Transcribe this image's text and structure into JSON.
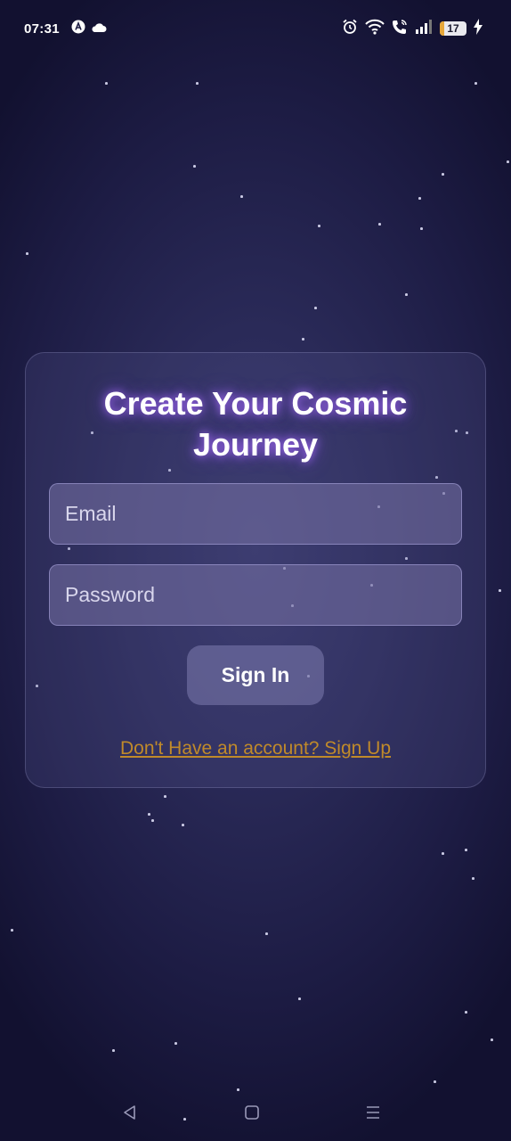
{
  "status_bar": {
    "time": "07:31",
    "left_icons": [
      "a-icon",
      "cloud-icon"
    ],
    "right_icons": [
      "alarm-icon",
      "wifi-icon",
      "wifi-call-icon",
      "signal-icon"
    ],
    "battery_level": "17",
    "charging_icon": "bolt-icon"
  },
  "login": {
    "title_line1": "Create Your Cosmic",
    "title_line2": "Journey",
    "email_placeholder": "Email",
    "password_placeholder": "Password",
    "signin_label": "Sign In",
    "signup_link": "Don't Have an account? Sign Up"
  },
  "colors": {
    "background_top": "#121130",
    "background_center": "#353567",
    "title_glow": "#a86eff",
    "link": "#c08a2a"
  },
  "nav": {
    "back": "back-icon",
    "home": "home-icon",
    "recents": "recents-icon"
  }
}
